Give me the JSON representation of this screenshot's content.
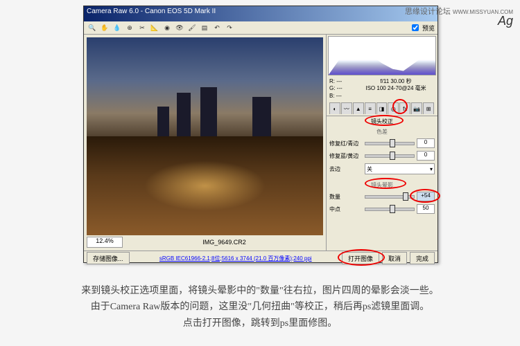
{
  "watermark": {
    "text": "思缘设计论坛",
    "url": "WWW.MISSYUAN.COM",
    "signature": "Ag"
  },
  "titlebar": {
    "title": "Camera Raw 6.0 - Canon EOS 5D Mark II"
  },
  "toolbar": {
    "preview_label": "预览"
  },
  "zoom": {
    "value": "12.4%"
  },
  "filename": "IMG_9649.CR2",
  "exif": {
    "r": "R: ---",
    "g": "G: ---",
    "b": "B: ---",
    "exposure": "f/11  30.00 秒",
    "iso": "ISO 100  24-70@24 毫米"
  },
  "tab": {
    "active_label": "镜头校正",
    "sub_label": "色差"
  },
  "sliders": {
    "red_cyan": {
      "label": "修复红/青边",
      "value": "0"
    },
    "blue_yellow": {
      "label": "修复蓝/黄边",
      "value": "0"
    },
    "defringe": {
      "label": "去边",
      "value": "关"
    },
    "vignette_section": "镜头晕影",
    "amount": {
      "label": "数量",
      "value": "+54"
    },
    "midpoint": {
      "label": "中点",
      "value": "50"
    }
  },
  "buttons": {
    "save": "存储图像...",
    "open": "打开图像",
    "cancel": "取消",
    "done": "完成"
  },
  "link": "sRGB IEC61966-2.1;8位;5616 x 3744 (21.0 百万像素);240 ppi",
  "caption": {
    "line1": "来到镜头校正选项里面，将镜头晕影中的\"数量\"往右拉，图片四周的晕影会淡一些。",
    "line2": "由于Camera Raw版本的问题，这里没\"几何扭曲\"等校正，稍后再ps滤镜里面调。",
    "line3": "点击打开图像，跳转到ps里面修图。"
  }
}
